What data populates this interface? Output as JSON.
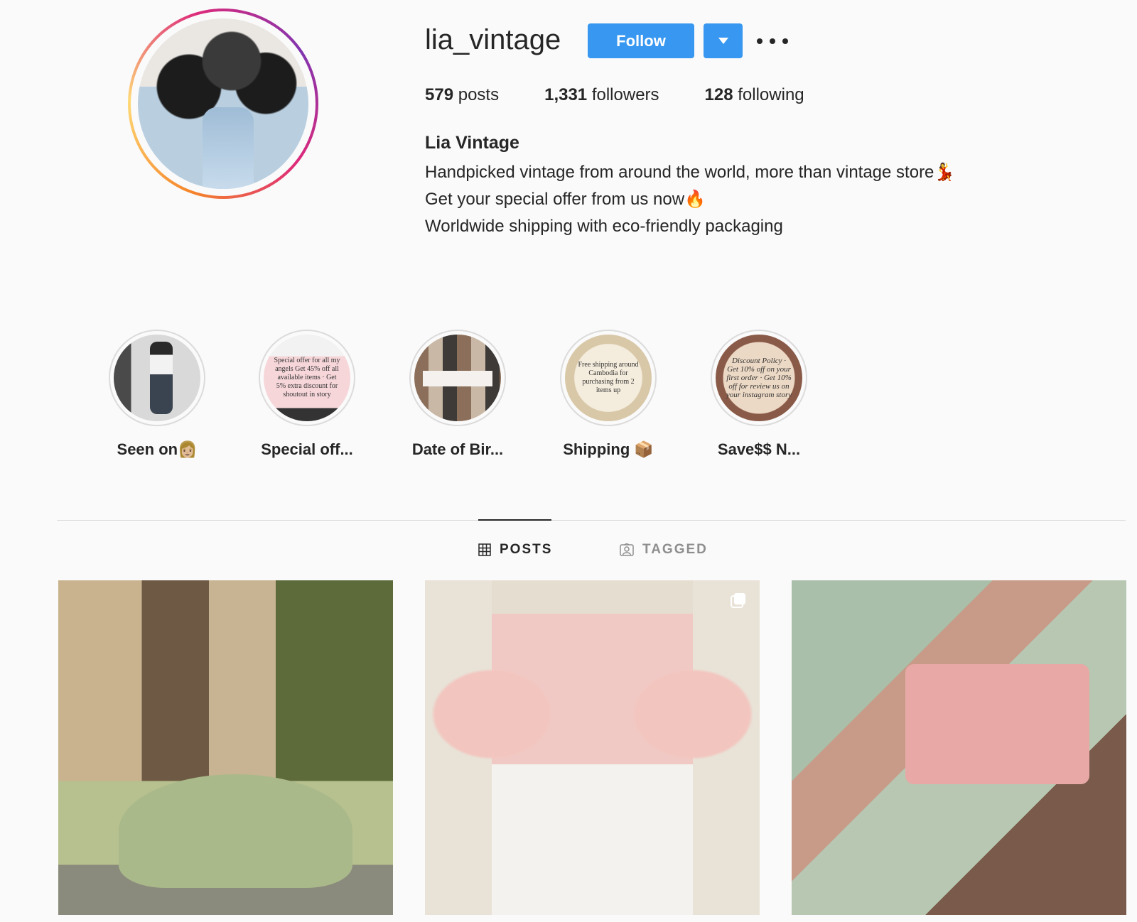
{
  "profile": {
    "username": "lia_vintage",
    "follow_label": "Follow",
    "stats": {
      "posts_count": "579",
      "posts_label": "posts",
      "followers_count": "1,331",
      "followers_label": "followers",
      "following_count": "128",
      "following_label": "following"
    },
    "full_name": "Lia Vintage",
    "bio": [
      "Handpicked vintage from around the world, more than vintage store💃",
      "Get your special offer from us now🔥",
      "Worldwide shipping with eco-friendly packaging"
    ]
  },
  "highlights": [
    {
      "label": "Seen on👩🏼",
      "text": ""
    },
    {
      "label": "Special off...",
      "text": "Special offer for all my angels Get 45% off all available items · Get 5% extra discount for shoutout in story"
    },
    {
      "label": "Date of Bir...",
      "text": ""
    },
    {
      "label": "Shipping 📦",
      "text": "Free shipping around Cambodia for purchasing from 2 items up"
    },
    {
      "label": "Save$$ N...",
      "text": "Discount Policy · Get 10% off on your first order · Get 10% off for review us on your instagram story"
    }
  ],
  "tabs": [
    {
      "label": "POSTS",
      "active": true
    },
    {
      "label": "TAGGED",
      "active": false
    }
  ],
  "colors": {
    "accent": "#3897f0",
    "text": "#262626",
    "muted": "#8e8e8e",
    "divider": "#dbdbdb",
    "background": "#fafafa"
  }
}
